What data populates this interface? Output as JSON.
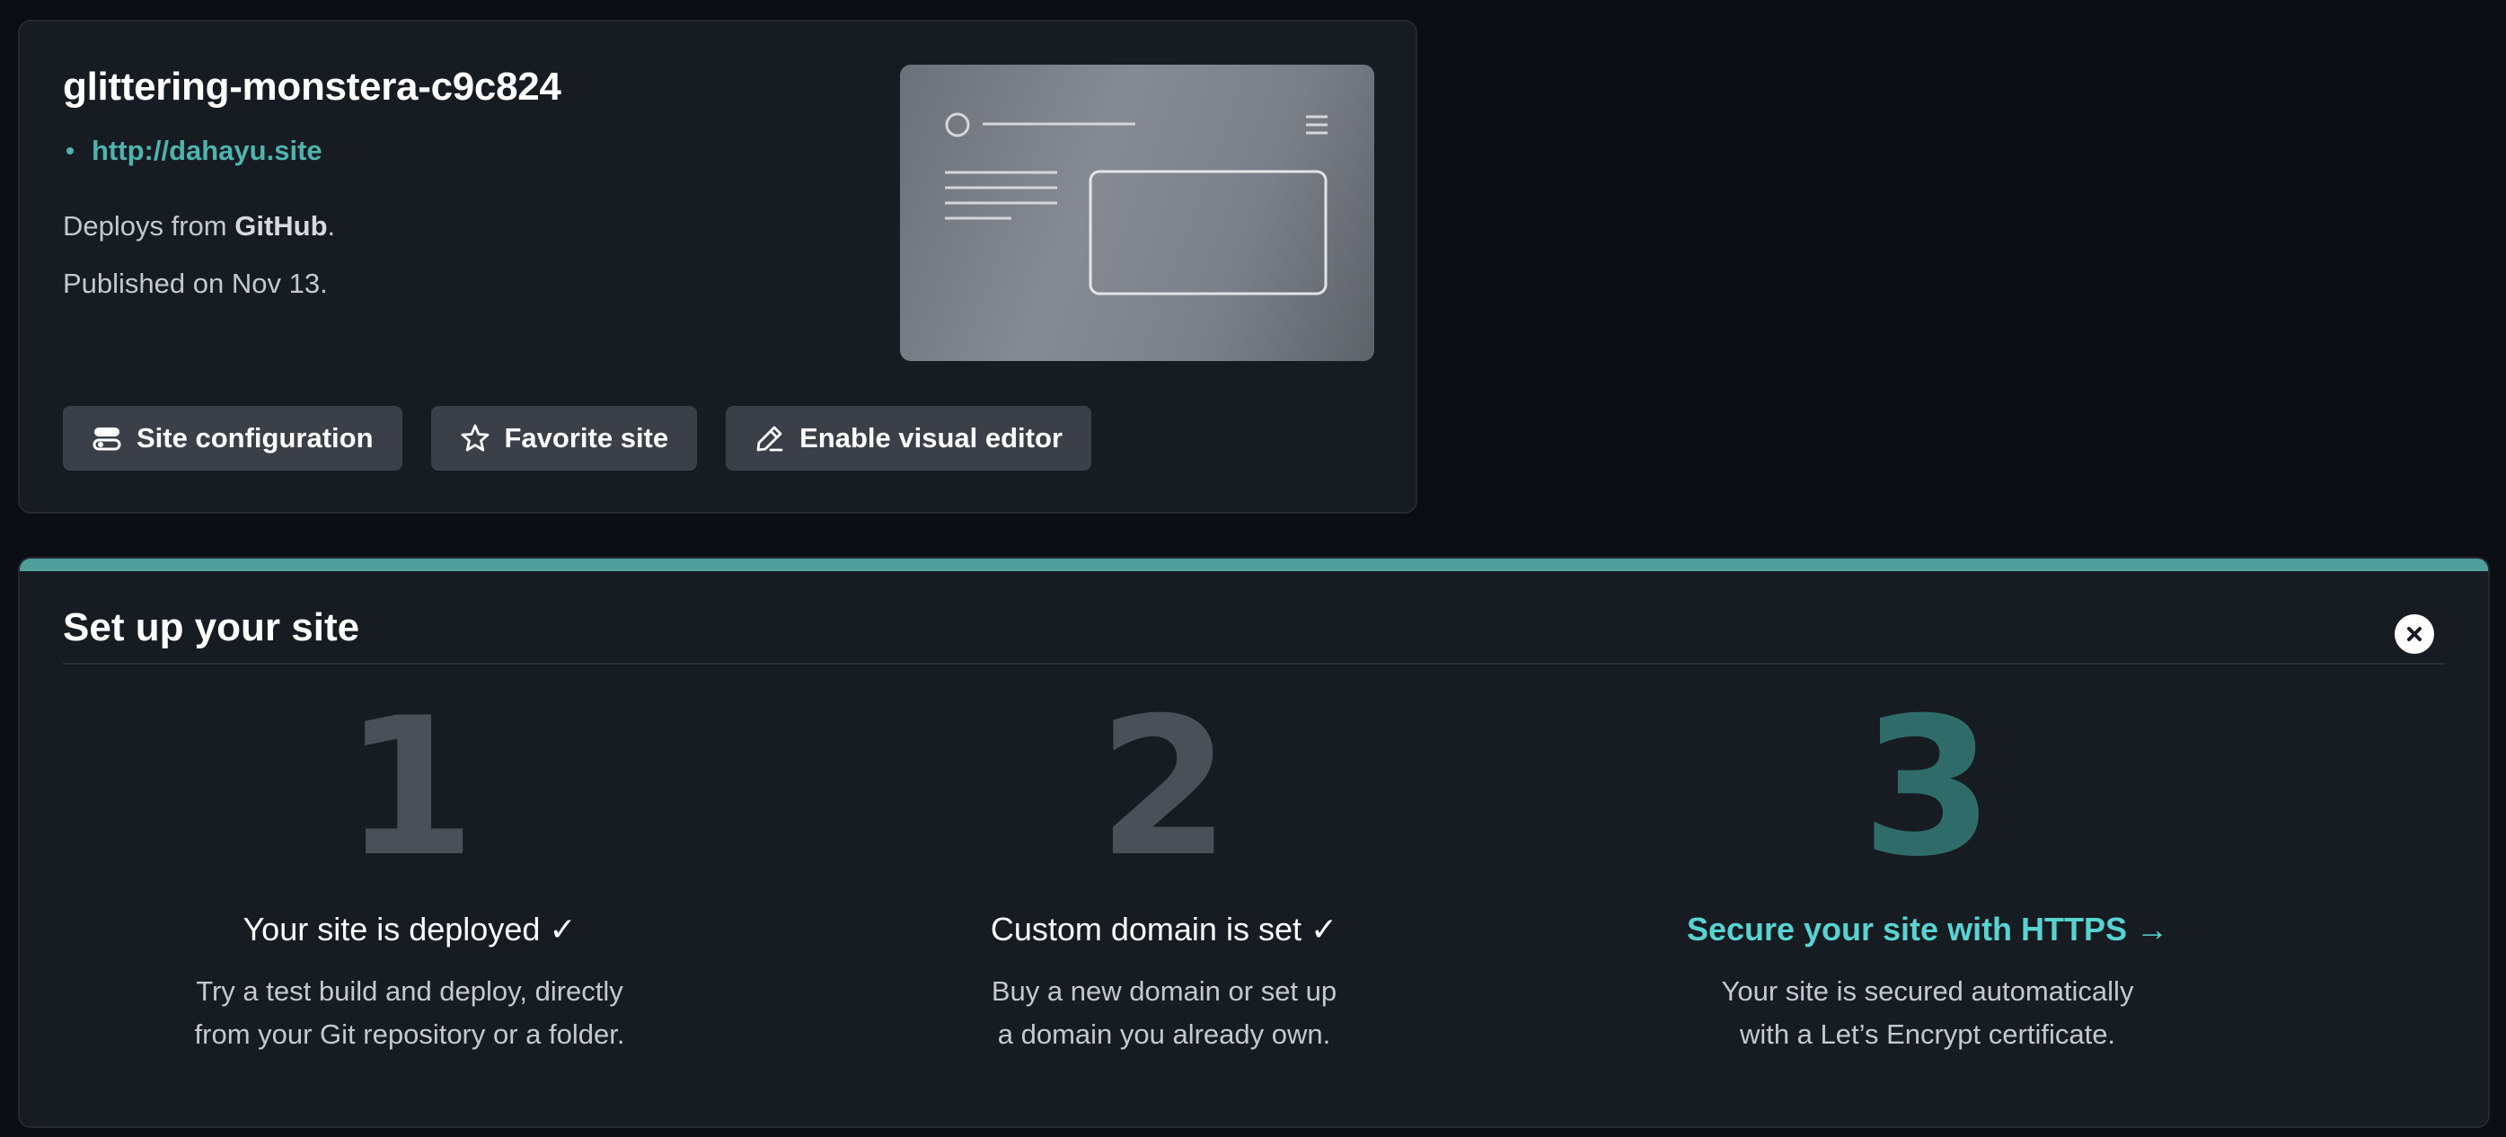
{
  "site": {
    "name": "glittering-monstera-c9c824",
    "url": "http://dahayu.site",
    "deploys_prefix": "Deploys from ",
    "deploys_source": "GitHub",
    "deploys_suffix": ".",
    "published": "Published on Nov 13.",
    "actions": {
      "configuration": "Site configuration",
      "favorite": "Favorite site",
      "visual_editor": "Enable visual editor"
    }
  },
  "setup": {
    "title": "Set up your site",
    "steps": [
      {
        "number": "1",
        "title": "Your site is deployed ✓",
        "desc_line1": "Try a test build and deploy, directly",
        "desc_line2": "from your Git repository or a folder."
      },
      {
        "number": "2",
        "title": "Custom domain is set ✓",
        "desc_line1": "Buy a new domain or set up",
        "desc_line2": "a domain you already own."
      },
      {
        "number": "3",
        "title": "Secure your site with HTTPS →",
        "desc_line1": "Your site is secured automatically",
        "desc_line2": "with a Let’s Encrypt certificate."
      }
    ]
  },
  "colors": {
    "accent": "#4e9f99",
    "link": "#4fb3ad",
    "cta": "#58d3d0",
    "button_bg": "#3b4048",
    "card_bg": "#171b22",
    "page_bg": "#0a0d12"
  },
  "icons": [
    "toggle-settings-icon",
    "star-icon",
    "pencil-icon",
    "close-icon",
    "site-preview-thumbnail"
  ]
}
